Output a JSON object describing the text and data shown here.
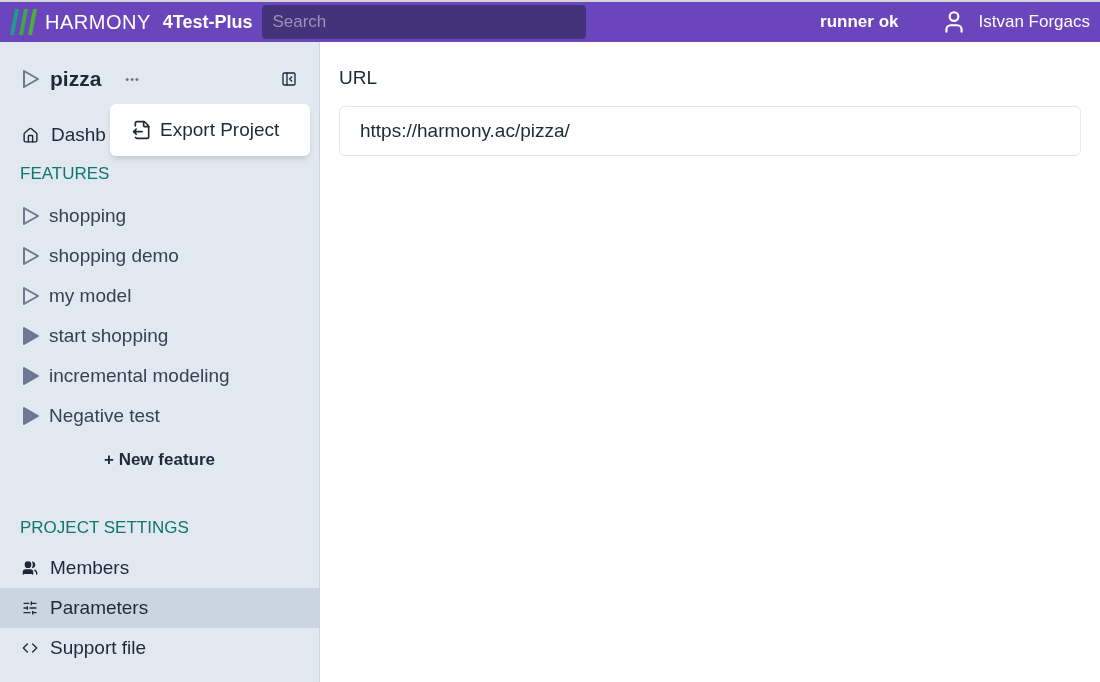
{
  "topbar": {
    "brand": "HARMONY",
    "product": "4Test-Plus",
    "search": {
      "placeholder": "Search"
    },
    "status": "runner ok",
    "user": "Istvan Forgacs"
  },
  "project": {
    "name": "pizza",
    "menu_button": "•••",
    "menu": {
      "items": [
        "Export Project"
      ]
    }
  },
  "dashboard": "Dashb",
  "features": {
    "heading": "FEATURES",
    "items": [
      {
        "label": "shopping",
        "filled": false
      },
      {
        "label": "shopping demo",
        "filled": false
      },
      {
        "label": "my model",
        "filled": false
      },
      {
        "label": "start shopping",
        "filled": true
      },
      {
        "label": "incremental modeling",
        "filled": true
      },
      {
        "label": "Negative test",
        "filled": true
      }
    ],
    "new_button": "+ New feature"
  },
  "settings": {
    "heading": "PROJECT SETTINGS",
    "items": [
      {
        "kind": "members",
        "label": "Members",
        "selected": false
      },
      {
        "kind": "parameters",
        "label": "Parameters",
        "selected": true
      },
      {
        "kind": "code",
        "label": "Support file",
        "selected": false
      }
    ]
  },
  "main": {
    "label": "URL",
    "value": "https://harmony.ac/pizza/"
  }
}
